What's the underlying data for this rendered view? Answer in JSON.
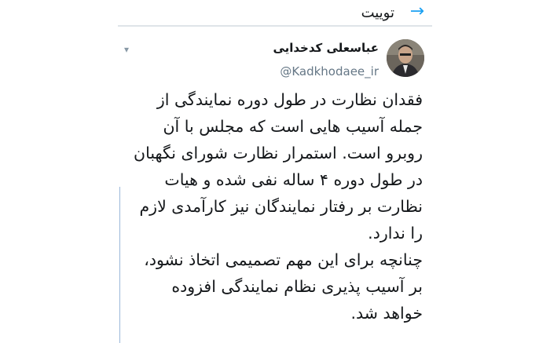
{
  "header": {
    "title": "توییت",
    "back_icon": "arrow-right-icon"
  },
  "tweet": {
    "display_name": "عباسعلی کدخدایی",
    "handle": "@Kadkhodaee_ir",
    "menu_icon": "chevron-down-icon",
    "lines": [
      "فقدان نظارت در طول دوره نمایندگی از",
      "جمله آسیب هایی است که مجلس با آن",
      "روبرو است. استمرار نظارت شورای نگهبان",
      "در طول دوره ۴ ساله نفی شده و هیات",
      "نظارت بر رفتار نمایندگان نیز کارآمدی لازم",
      "را ندارد.",
      "چنانچه برای این مهم  تصمیمی اتخاذ نشود،",
      "بر آسیب پذیری نظام نمایندگی افزوده",
      "خواهد شد."
    ]
  },
  "colors": {
    "accent": "#1da1f2",
    "text": "#14171a",
    "secondary": "#657786"
  }
}
